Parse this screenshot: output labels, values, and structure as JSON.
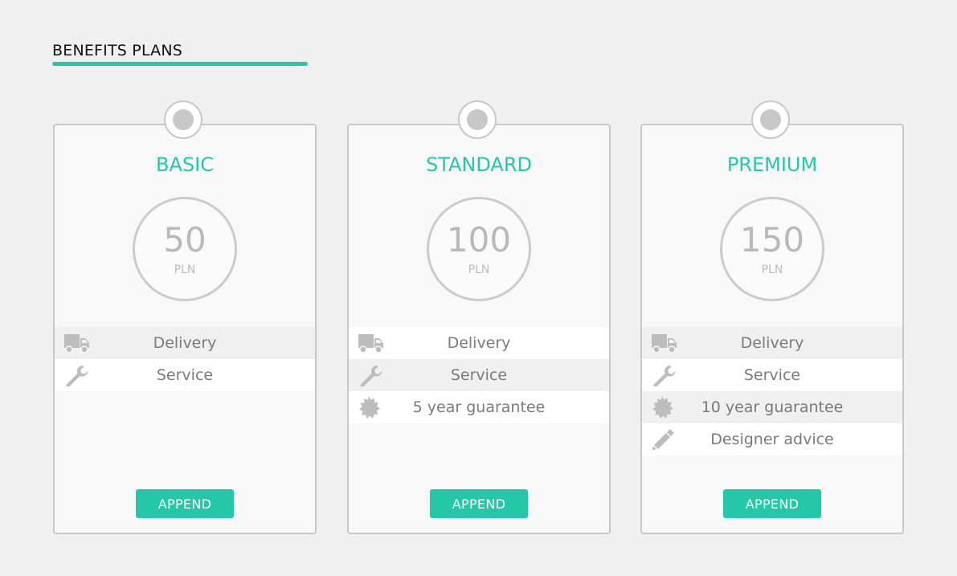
{
  "page": {
    "heading": "BENEFITS PLANS",
    "accent_color": "#26c6a9"
  },
  "plans": [
    {
      "name": "BASIC",
      "price": "50",
      "currency": "PLN",
      "button_label": "APPEND",
      "features": [
        {
          "icon": "truck-icon",
          "label": "Delivery"
        },
        {
          "icon": "wrench-icon",
          "label": "Service"
        }
      ]
    },
    {
      "name": "STANDARD",
      "price": "100",
      "currency": "PLN",
      "button_label": "APPEND",
      "features": [
        {
          "icon": "truck-icon",
          "label": "Delivery"
        },
        {
          "icon": "wrench-icon",
          "label": "Service"
        },
        {
          "icon": "badge-icon",
          "label": "5 year guarantee"
        }
      ]
    },
    {
      "name": "PREMIUM",
      "price": "150",
      "currency": "PLN",
      "button_label": "APPEND",
      "features": [
        {
          "icon": "truck-icon",
          "label": "Delivery"
        },
        {
          "icon": "wrench-icon",
          "label": "Service"
        },
        {
          "icon": "badge-icon",
          "label": "10 year guarantee"
        },
        {
          "icon": "pencil-icon",
          "label": "Designer advice"
        }
      ]
    }
  ]
}
